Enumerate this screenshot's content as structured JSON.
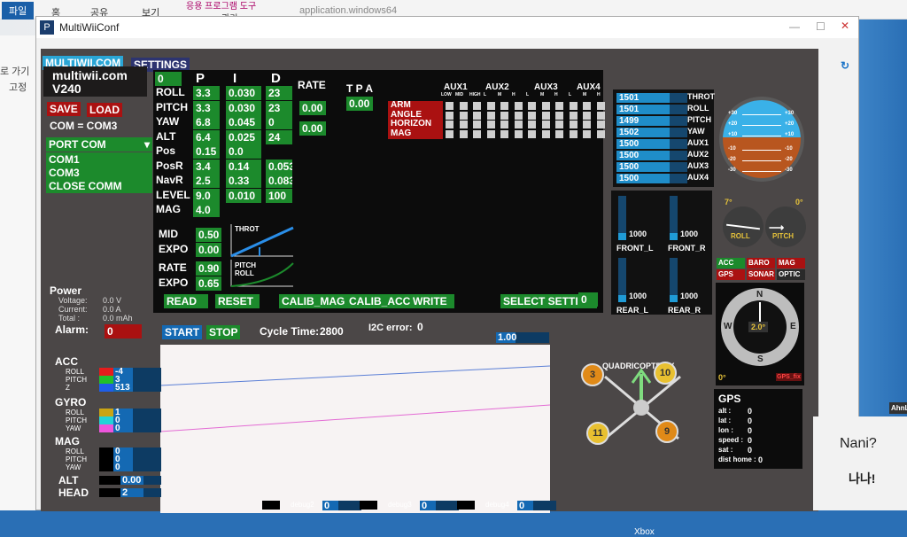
{
  "explorer": {
    "tabs": [
      "파일",
      "홈",
      "공유",
      "보기",
      "관리"
    ],
    "ribbon_tool": "응용 프로그램 도구",
    "window_title": "application.windows64",
    "side_text": [
      "로 가기",
      "고정"
    ]
  },
  "window": {
    "title": "MultiWiiConf"
  },
  "header": {
    "tab_multiwii": "MULTIWII.COM",
    "tab_settings": "SETTINGS",
    "logo_line1": "multiwii.com",
    "logo_line2": "V240"
  },
  "left": {
    "save": "SAVE",
    "load": "LOAD",
    "com_status": "COM = COM3",
    "port_com": "PORT COM",
    "ports": [
      "COM1",
      "COM3",
      "CLOSE COMM"
    ]
  },
  "power": {
    "title": "Power",
    "voltage_label": "Voltage:",
    "voltage": "0.0 V",
    "current_label": "Current:",
    "current": "0.0 A",
    "total_label": "Total :",
    "total": "0.0 mAh",
    "alarm_label": "Alarm:",
    "alarm": "0"
  },
  "pid": {
    "setting_index": "0",
    "headers": {
      "p": "P",
      "i": "I",
      "d": "D",
      "rate": "RATE",
      "tpa": "T P A"
    },
    "rows": [
      {
        "name": "ROLL",
        "p": "3.3",
        "i": "0.030",
        "d": "23"
      },
      {
        "name": "PITCH",
        "p": "3.3",
        "i": "0.030",
        "d": "23"
      },
      {
        "name": "YAW",
        "p": "6.8",
        "i": "0.045",
        "d": "0"
      },
      {
        "name": "ALT",
        "p": "6.4",
        "i": "0.025",
        "d": "24"
      },
      {
        "name": "Pos",
        "p": "0.15",
        "i": "0.0",
        "d": ""
      },
      {
        "name": "PosR",
        "p": "3.4",
        "i": "0.14",
        "d": "0.053"
      },
      {
        "name": "NavR",
        "p": "2.5",
        "i": "0.33",
        "d": "0.083"
      },
      {
        "name": "LEVEL",
        "p": "9.0",
        "i": "0.010",
        "d": "100"
      },
      {
        "name": "MAG",
        "p": "4.0",
        "i": "",
        "d": ""
      }
    ],
    "rate_rollpitch": "0.00",
    "rate_yaw": "0.00",
    "tpa": "0.00",
    "mid_label": "MID",
    "mid": "0.50",
    "expo_label": "EXPO",
    "expo": "0.00",
    "throt_label": "THROT",
    "rate_label": "RATE",
    "rate": "0.90",
    "expo2": "0.65",
    "pitch_label": "PITCH",
    "roll_label": "ROLL"
  },
  "aux": {
    "headers": [
      "AUX1",
      "AUX2",
      "AUX3",
      "AUX4"
    ],
    "sub": [
      "LOW",
      "MID",
      "HIGH",
      "L",
      "M",
      "H",
      "L",
      "M",
      "H",
      "L",
      "M",
      "H"
    ],
    "modes": [
      "ARM",
      "ANGLE",
      "HORIZON",
      "MAG"
    ]
  },
  "buttons": {
    "read": "READ",
    "reset": "RESET",
    "calib_mag": "CALIB_MAG",
    "calib_acc": "CALIB_ACC",
    "write": "WRITE",
    "select_setting": "SELECT SETTING",
    "select_value": "0"
  },
  "rc": [
    {
      "v": "1501",
      "n": "THROT"
    },
    {
      "v": "1501",
      "n": "ROLL"
    },
    {
      "v": "1499",
      "n": "PITCH"
    },
    {
      "v": "1502",
      "n": "YAW"
    },
    {
      "v": "1500",
      "n": "AUX1"
    },
    {
      "v": "1500",
      "n": "AUX2"
    },
    {
      "v": "1500",
      "n": "AUX3"
    },
    {
      "v": "1500",
      "n": "AUX4"
    }
  ],
  "motors": [
    {
      "v": "1000",
      "n": "FRONT_L"
    },
    {
      "v": "1000",
      "n": "FRONT_R"
    },
    {
      "v": "1000",
      "n": "REAR_L"
    },
    {
      "v": "1000",
      "n": "REAR_R"
    }
  ],
  "attitude": {
    "roll_deg": "7°",
    "pitch_deg": "0°",
    "roll": "ROLL",
    "pitch": "PITCH",
    "horizon_ticks": [
      "+30",
      "+20",
      "+10",
      "-10",
      "-20",
      "-30"
    ]
  },
  "sensors": [
    {
      "n": "ACC",
      "on": true
    },
    {
      "n": "BARO",
      "on": false
    },
    {
      "n": "MAG",
      "on": false
    },
    {
      "n": "GPS",
      "on": false
    },
    {
      "n": "SONAR",
      "on": false
    },
    {
      "n": "OPTIC",
      "on": null
    }
  ],
  "compass": {
    "n": "N",
    "e": "E",
    "s": "S",
    "w": "W",
    "heading": "2.0°",
    "alt_deg": "0°",
    "gps_fix": "GPS_fix"
  },
  "gps": {
    "title": "GPS",
    "rows": [
      {
        "k": "alt :",
        "v": "0"
      },
      {
        "k": "lat :",
        "v": "0"
      },
      {
        "k": "lon :",
        "v": "0"
      },
      {
        "k": "speed :",
        "v": "0"
      },
      {
        "k": "sat :",
        "v": "0"
      },
      {
        "k": "dist home :",
        "v": "0"
      }
    ]
  },
  "quad": {
    "title": "QUADRICOPTER X",
    "motors": [
      "3",
      "10",
      "11",
      "9"
    ]
  },
  "graph": {
    "start": "START",
    "stop": "STOP",
    "cycle_time_label": "Cycle Time:",
    "cycle_time": "2800",
    "i2c_label": "I2C error:",
    "i2c": "0",
    "scale": "1.00"
  },
  "sensor_values": {
    "acc": {
      "title": "ACC",
      "labels": [
        "ROLL",
        "PITCH",
        "Z"
      ],
      "values": [
        "-4",
        "3",
        "513"
      ],
      "colors": [
        "#e51c1c",
        "#22c02a",
        "#1e5ee8"
      ]
    },
    "gyro": {
      "title": "GYRO",
      "labels": [
        "ROLL",
        "PITCH",
        "YAW"
      ],
      "values": [
        "1",
        "0",
        "0"
      ],
      "colors": [
        "#c9a414",
        "#22d3d8",
        "#ee55dd"
      ]
    },
    "mag": {
      "title": "MAG",
      "labels": [
        "ROLL",
        "PITCH",
        "YAW"
      ],
      "values": [
        "0",
        "0",
        "0"
      ]
    },
    "alt": {
      "title": "ALT",
      "value": "0.00"
    },
    "head": {
      "title": "HEAD",
      "value": "2"
    },
    "debug": [
      {
        "n": "debug2",
        "v": "0"
      },
      {
        "n": "debug3",
        "v": "0"
      },
      {
        "n": "debug4",
        "v": "0"
      }
    ]
  },
  "taskbar": {
    "xbox": "Xbox"
  },
  "sticker": {
    "line1": "Nani?",
    "line2": "나나!",
    "corner": "AhnL"
  }
}
